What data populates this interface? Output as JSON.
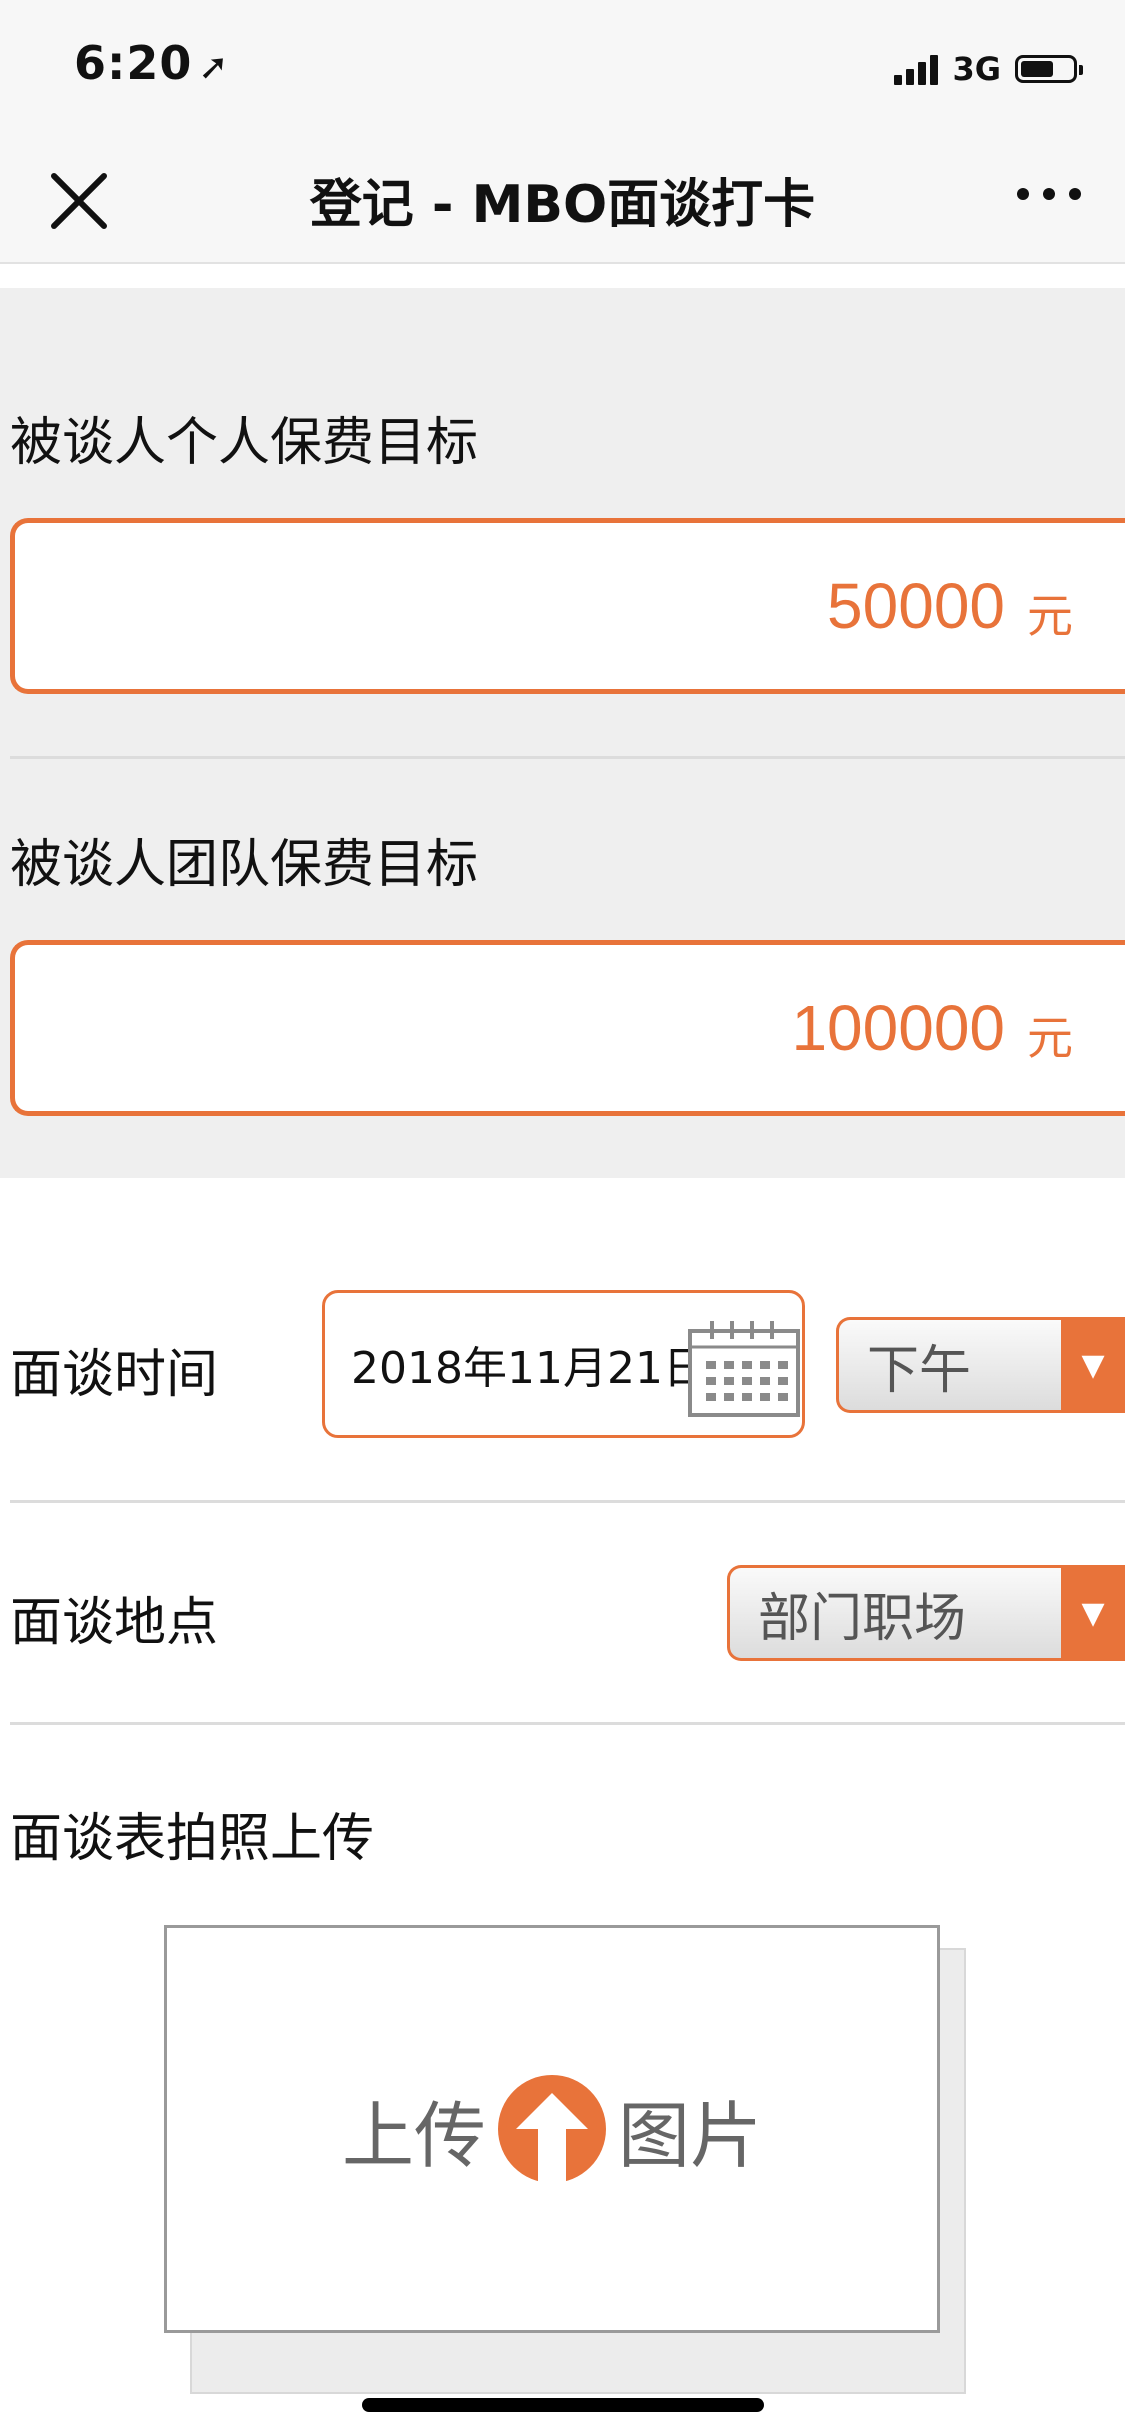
{
  "status_bar": {
    "time": "6:20",
    "network": "3G"
  },
  "nav": {
    "title": "登记 - MBO面谈打卡"
  },
  "personal_target": {
    "label": "被谈人个人保费目标",
    "value": "50000",
    "unit": "元"
  },
  "team_target": {
    "label": "被谈人团队保费目标",
    "value": "100000",
    "unit": "元"
  },
  "interview_time": {
    "label": "面谈时间",
    "date": "2018年11月21日",
    "period": "下午"
  },
  "interview_place": {
    "label": "面谈地点",
    "value": "部门职场"
  },
  "photo_upload": {
    "label": "面谈表拍照上传",
    "button_left": "上传",
    "button_right": "图片"
  },
  "colors": {
    "accent": "#e8733a"
  }
}
